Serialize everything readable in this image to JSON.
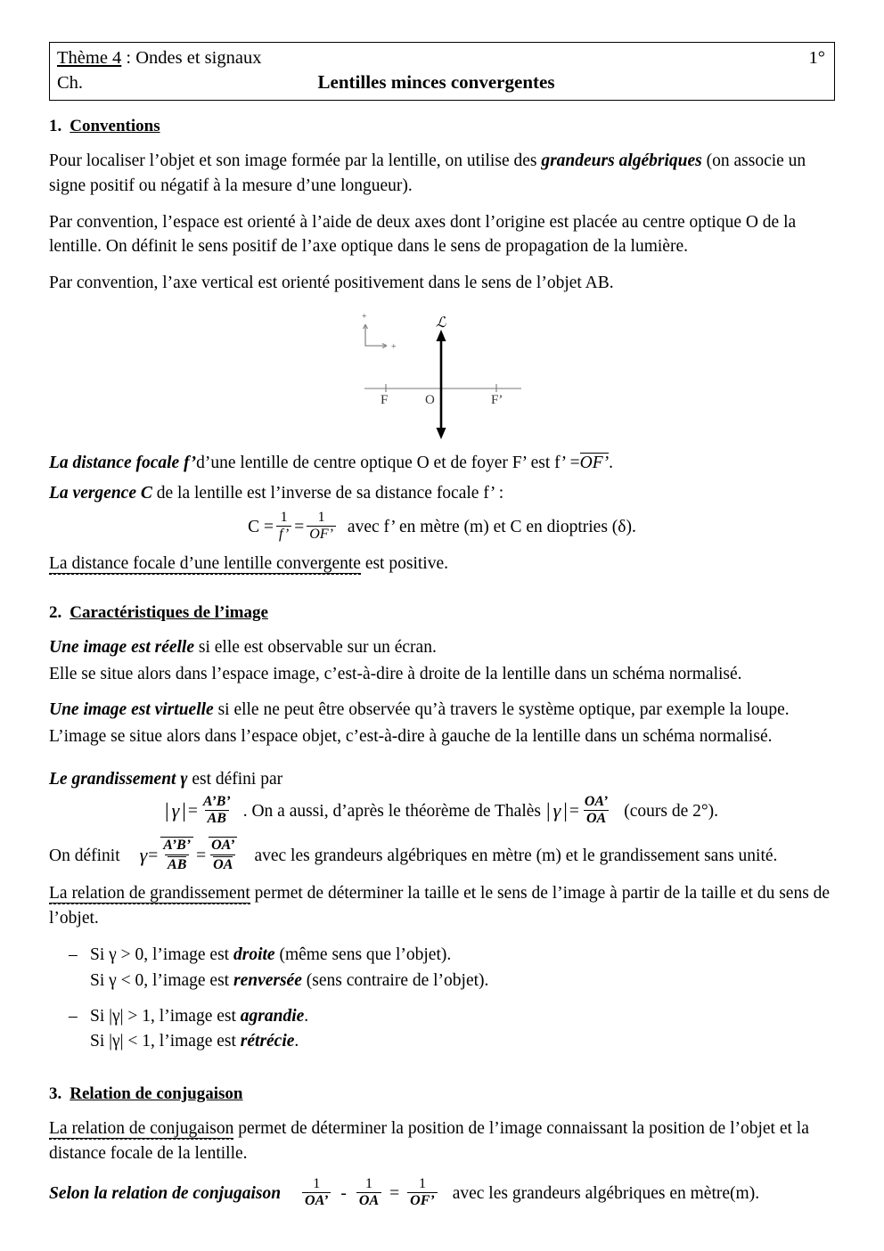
{
  "header": {
    "theme_label": "Thème 4",
    "theme_rest": " : Ondes et signaux",
    "ch_label": "Ch.",
    "title": "Lentilles minces convergentes",
    "level": "1°"
  },
  "sections": [
    {
      "number": "1.",
      "title": "Conventions"
    },
    {
      "number": "2.",
      "title": "Caractéristiques de l’image"
    },
    {
      "number": "3.",
      "title": "Relation de conjugaison"
    }
  ],
  "conventions": {
    "p1_a": "Pour localiser l’objet et son image formée par la lentille, on utilise des ",
    "p1_b": "grandeurs algébriques",
    "p1_c": " (on associe un signe positif ou négatif à la mesure d’une longueur).",
    "p2": "Par convention, l’espace est orienté à l’aide de deux axes dont l’origine est placée au centre optique O de la lentille. On définit le sens positif de l’axe optique dans le sens de propagation de la lumière.",
    "p3": "Par convention, l’axe vertical est orienté positivement dans le sens de l’objet AB."
  },
  "diagram": {
    "lens_label": "ℒ",
    "focal_left_label": "F",
    "center_label": "O",
    "focal_right_label": "F’",
    "plus_vertical": "+",
    "plus_horizontal": "+"
  },
  "focale": {
    "def_bold": "La distance focale f’",
    "def_rest": " d’une lentille de centre optique O et de foyer F’ est f’ = ",
    "def_vector": "OF’",
    "def_end": ".",
    "vergence_bold": "La vergence C",
    "vergence_rest": " de la lentille est l’inverse de sa distance focale f’ :",
    "formula": {
      "lhs": "C =",
      "num1": "1",
      "den1": "f’",
      "eq": "=",
      "num2": "1",
      "den2": "OF’",
      "tail": "avec f’ en mètre (m) et C en dioptries (δ)."
    },
    "positive_underlined": "La distance focale d’une lentille convergente",
    "positive_rest": " est positive."
  },
  "image_carac": {
    "reelle_bold": "Une image est réelle",
    "reelle_rest": " si elle est observable sur un écran.",
    "reelle_line2": "Elle se situe alors dans l’espace image, c’est-à-dire à droite de la lentille dans un schéma normalisé.",
    "virtuelle_bold": "Une image est virtuelle",
    "virtuelle_rest": " si elle ne peut être observée qu’à travers le système optique, par exemple la loupe.",
    "virtuelle_line2": "L’image se situe alors dans l’espace objet, c’est-à-dire à gauche de la lentille dans un schéma normalisé."
  },
  "grandissement": {
    "intro_bold": "Le grandissement γ",
    "intro_rest": " est défini par",
    "formula1": {
      "abs_open": "|",
      "gamma": "γ",
      "abs_close": "|",
      "eq": "=",
      "num": "A’B’",
      "den": "AB"
    },
    "middle_text": ". On a aussi, d’après le théorème de Thalès",
    "formula2": {
      "abs_open": "|",
      "gamma": "γ",
      "abs_close": "|",
      "eq": "=",
      "num": "OA’",
      "den": "OA"
    },
    "cours_note": "(cours de 2°).",
    "definit_label": "On définit",
    "formula3": {
      "gamma": "γ",
      "eq1": "=",
      "num1": "A’B’",
      "den1": "AB",
      "eq2": "=",
      "num2": "OA’",
      "den2": "OA"
    },
    "definit_tail": "avec les grandeurs algébriques en mètre (m) et le grandissement sans unité.",
    "relation_underlined": "La relation de grandissement",
    "relation_rest": " permet de déterminer la taille et le sens de l’image à partir de la taille et du sens de l’objet.",
    "bullets": [
      {
        "dash": "–",
        "line1_a": "Si γ > 0, l’image est ",
        "line1_b": "droite",
        "line1_c": " (même sens que l’objet).",
        "line2_a": "Si γ < 0, l’image est ",
        "line2_b": "renversée",
        "line2_c": " (sens contraire de l’objet)."
      },
      {
        "dash": "–",
        "line1_a": "Si |γ| > 1, l’image est ",
        "line1_b": "agrandie",
        "line1_c": ".",
        "line2_a": "Si |γ| < 1, l’image est ",
        "line2_b": "rétrécie",
        "line2_c": "."
      }
    ]
  },
  "conjugaison": {
    "intro_underlined": "La relation de conjugaison",
    "intro_rest": " permet de déterminer la position de l’image connaissant la position de l’objet et la distance focale de la lentille.",
    "selon_bold": "Selon la relation de conjugaison",
    "formula": {
      "num1": "1",
      "den1": "OA’",
      "minus": "-",
      "num2": "1",
      "den2": "OA",
      "eq": "=",
      "num3": "1",
      "den3": "OF’"
    },
    "tail": "avec les grandeurs algébriques en mètre(m)."
  }
}
